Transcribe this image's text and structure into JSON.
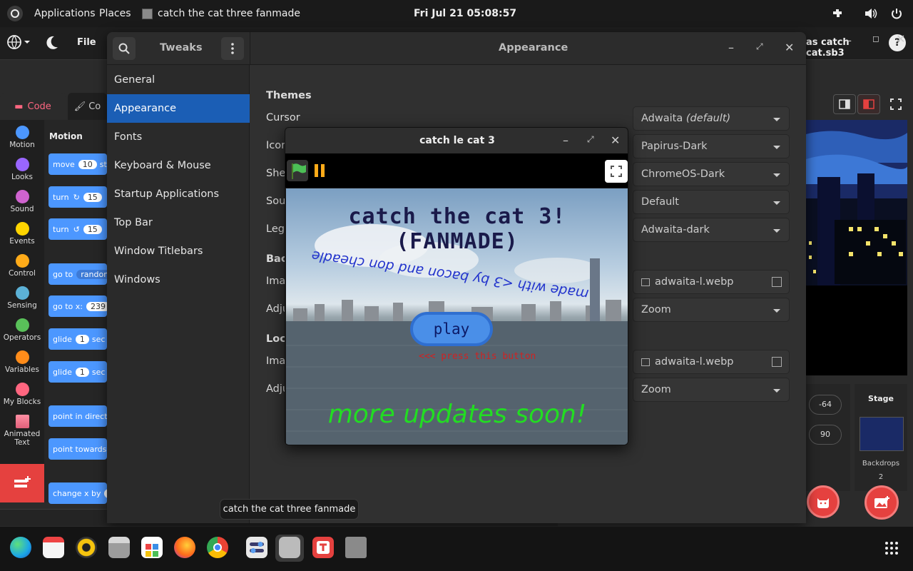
{
  "topbar": {
    "applications": "Applications",
    "places": "Places",
    "window_title": "catch the cat three fanmade",
    "clock": "Fri Jul 21  05:08:57"
  },
  "scratch": {
    "file_menu": "File",
    "project_title": "as catch cat.sb3",
    "tabs": {
      "code": "Code",
      "costumes": "Co"
    },
    "categories": [
      {
        "label": "Motion",
        "color": "#4c97ff"
      },
      {
        "label": "Looks",
        "color": "#9966ff"
      },
      {
        "label": "Sound",
        "color": "#cf63cf"
      },
      {
        "label": "Events",
        "color": "#ffd500"
      },
      {
        "label": "Control",
        "color": "#ffab19"
      },
      {
        "label": "Sensing",
        "color": "#5cb1d6"
      },
      {
        "label": "Operators",
        "color": "#59c059"
      },
      {
        "label": "Variables",
        "color": "#ff8c1a"
      },
      {
        "label": "My Blocks",
        "color": "#ff6680"
      },
      {
        "label": "Animated Text",
        "color": "#e0607a"
      }
    ],
    "palette_header": "Motion",
    "blocks": {
      "move": "move",
      "move_val": "10",
      "move_tail": "st",
      "turn": "turn",
      "turn_val": "15",
      "turn2_val": "15",
      "goto": "go to",
      "goto_val": "random",
      "gotoxy": "go to x:",
      "gotoxy_val": "239",
      "glide": "glide",
      "glide_val": "1",
      "glide_tail": "sec",
      "glide2_val": "1",
      "glide2_tail": "sec",
      "pointdir": "point in direction",
      "pointtow": "point towards",
      "changex": "change x by",
      "changex_val": "1"
    },
    "sprite_info": {
      "y": "-64",
      "direction": "90"
    },
    "stage_panel": {
      "label": "Stage",
      "backdrops_label": "Backdrops",
      "backdrops_count": "2"
    }
  },
  "tweaks": {
    "search_icon": "search-icon",
    "title": "Tweaks",
    "pane_title": "Appearance",
    "nav": [
      "General",
      "Appearance",
      "Fonts",
      "Keyboard & Mouse",
      "Startup Applications",
      "Top Bar",
      "Window Titlebars",
      "Windows"
    ],
    "selected_nav": "Appearance",
    "themes_header": "Themes",
    "rows": {
      "cursor": "Cursor",
      "icons": "Icon",
      "shell": "Shel",
      "sound": "Sou",
      "legacy": "Lega",
      "background_header": "Bac",
      "image": "Ima",
      "adjust": "Adju",
      "lock_header": "Loc",
      "lock_image": "Ima",
      "lock_adjust": "Adju"
    },
    "values": {
      "cursor": "Adwaita",
      "cursor_default": "(default)",
      "icons": "Papirus-Dark",
      "shell": "ChromeOS-Dark",
      "sound": "Default",
      "legacy": "Adwaita-dark",
      "bg_image": "adwaita-l.webp",
      "bg_adjust": "Zoom",
      "lock_image": "adwaita-l.webp",
      "lock_adjust": "Zoom"
    }
  },
  "game": {
    "title": "catch le cat 3",
    "heading": "catch the cat 3! (FANMADE)",
    "credit": "made with <3 by bacon and don cheadle",
    "play": "play",
    "press": "<<< press this button",
    "updates": "more updates soon!"
  },
  "tooltip": "catch the cat three fanmade",
  "colors": {
    "accent": "#1b5eb5",
    "scratch_blue": "#4c97ff",
    "game_green": "#22dd22",
    "add_button": "#e5413f"
  }
}
